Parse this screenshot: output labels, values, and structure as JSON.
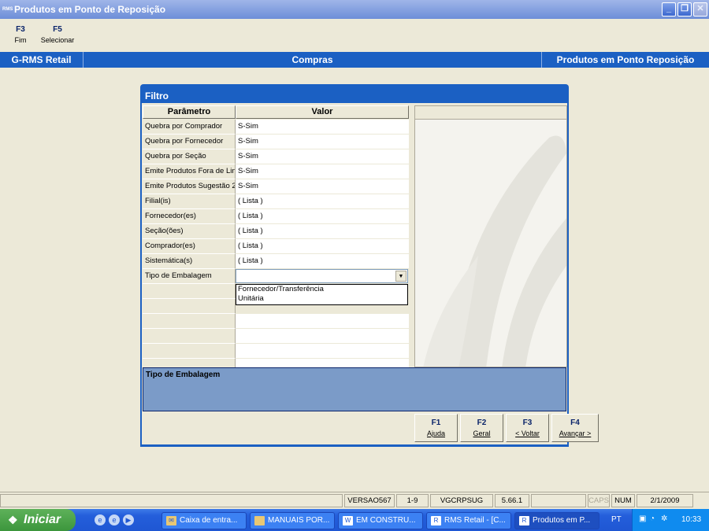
{
  "window": {
    "app_icon_text": "RMS",
    "title": "Produtos em Ponto de Reposição",
    "minimize": "_",
    "maximize": "❐",
    "close": "✕"
  },
  "fkeys": [
    {
      "key": "F3",
      "label": "Fim"
    },
    {
      "key": "F5",
      "label": "Selecionar"
    }
  ],
  "header": {
    "system": "G-RMS Retail",
    "module": "Compras",
    "screen": "Produtos em Ponto Reposição"
  },
  "dialog": {
    "title": "Filtro",
    "columns": {
      "param": "Parâmetro",
      "value": "Valor"
    },
    "rows": [
      {
        "param": "Quebra por Comprador",
        "value": "S-Sim"
      },
      {
        "param": "Quebra por Fornecedor",
        "value": "S-Sim"
      },
      {
        "param": "Quebra por Seção",
        "value": "S-Sim"
      },
      {
        "param": "Emite Produtos Fora de Lin",
        "value": "S-Sim"
      },
      {
        "param": "Emite Produtos Sugestão 2",
        "value": "S-Sim"
      },
      {
        "param": "Filial(is)",
        "value": "( Lista )"
      },
      {
        "param": "Fornecedor(es)",
        "value": "( Lista )"
      },
      {
        "param": "Seção(ões)",
        "value": "( Lista )"
      },
      {
        "param": "Comprador(es)",
        "value": "( Lista )"
      },
      {
        "param": "Sistemática(s)",
        "value": "( Lista )"
      }
    ],
    "combo_row": {
      "param": "Tipo de Embalagem",
      "value": "",
      "arrow": "▼"
    },
    "dropdown_options": [
      "Fornecedor/Transferência",
      "Unitária"
    ],
    "description_title": "Tipo de Embalagem",
    "buttons": [
      {
        "key": "F1",
        "label": "Ajuda"
      },
      {
        "key": "F2",
        "label": "Geral"
      },
      {
        "key": "F3",
        "label": "< Voltar"
      },
      {
        "key": "F4",
        "label": "Avançar >"
      }
    ]
  },
  "status": {
    "version": "VERSAO567",
    "page": "1-9",
    "program": "VGCRPSUG",
    "release": "5.66.1",
    "caps": "CAPS",
    "num": "NUM",
    "date": "2/1/2009"
  },
  "taskbar": {
    "start": "Iniciar",
    "items": [
      {
        "label": "Caixa de entra...",
        "icon": "mail-icon"
      },
      {
        "label": "MANUAIS POR...",
        "icon": "folder-icon"
      },
      {
        "label": "EM CONSTRU...",
        "icon": "word-icon"
      },
      {
        "label": "RMS Retail - [C...",
        "icon": "rms-icon"
      },
      {
        "label": "Produtos em P...",
        "icon": "rms-icon"
      }
    ],
    "lang": "PT",
    "clock": "10:33"
  }
}
